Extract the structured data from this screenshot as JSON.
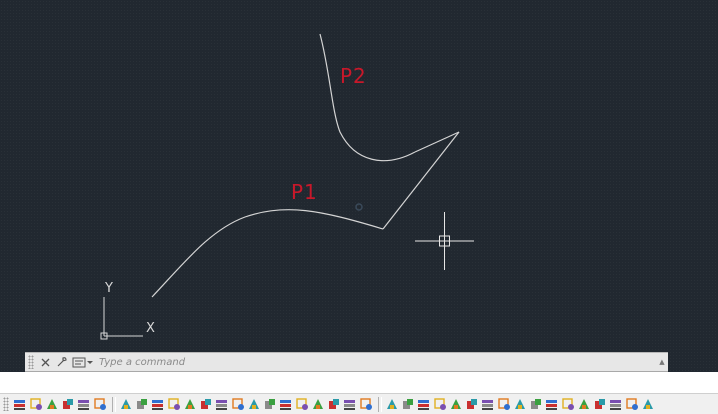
{
  "drawing": {
    "label_p1": "P1",
    "label_p2": "P2",
    "ucs_x": "X",
    "ucs_y": "Y",
    "colors": {
      "background": "#212830",
      "linework": "#d4d4d4",
      "labels": "#c8182a"
    }
  },
  "command_line": {
    "placeholder": "Type a command",
    "icons": [
      "close-icon",
      "settings-icon",
      "command-history-icon"
    ]
  },
  "toolbar": {
    "groups": [
      [
        "layer-properties-icon",
        "layer-state-icon",
        "layer-isolate-icon",
        "layer-freeze-icon",
        "layer-off-icon",
        "layer-lock-icon"
      ],
      [
        "layer-match-icon",
        "layer-previous-icon",
        "layer-walk-icon",
        "layer-merge-icon",
        "layer-delete-icon",
        "layer-color-icon",
        "layer-copy-icon",
        "layer-unisolate-icon",
        "layer-thaw-icon",
        "layer-on-icon",
        "layer-unlock-icon",
        "layer-change-icon",
        "layer-current-icon",
        "layer-translate-icon",
        "layer-filter-icon",
        "layer-settings-icon"
      ],
      [
        "view-3d-icon",
        "view-top-icon",
        "view-bottom-icon",
        "view-left-icon",
        "view-right-icon",
        "view-front-icon",
        "view-back-icon",
        "view-sw-icon",
        "view-se-icon",
        "view-ne-icon",
        "view-nw-icon",
        "view-orbit-icon",
        "view-camera-icon",
        "view-walk-icon",
        "view-fly-icon",
        "view-zoom-icon",
        "view-pan-icon"
      ]
    ]
  }
}
